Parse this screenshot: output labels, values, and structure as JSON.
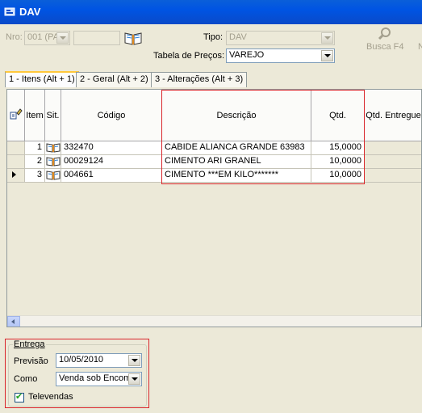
{
  "window": {
    "title": "DAV"
  },
  "form": {
    "nro_label": "Nro:",
    "nro_value": "001 (PA'",
    "nro2_value": "",
    "tipo_label": "Tipo:",
    "tipo_value": "DAV",
    "tabela_label": "Tabela de Preços:",
    "tabela_value": "VAREJO",
    "busca_label": "Busca F4"
  },
  "tabs": [
    {
      "label": "1 - Itens (Alt + 1)"
    },
    {
      "label": "2 - Geral (Alt + 2)"
    },
    {
      "label": "3 - Alterações (Alt + 3)"
    }
  ],
  "grid": {
    "columns": [
      "Item",
      "Sit.",
      "Código",
      "Descrição",
      "Qtd.",
      "Qtd. Entregue"
    ],
    "rows": [
      {
        "item": "1",
        "codigo": "332470",
        "descricao": "CABIDE ALIANCA GRANDE 63983",
        "qtd": "15,0000",
        "entregue": ""
      },
      {
        "item": "2",
        "codigo": "00029124",
        "descricao": "CIMENTO ARI GRANEL",
        "qtd": "10,0000",
        "entregue": ""
      },
      {
        "item": "3",
        "codigo": "004661",
        "descricao": "CIMENTO ***EM KILO*******",
        "qtd": "10,0000",
        "entregue": ""
      }
    ]
  },
  "entrega": {
    "legend": "Entrega",
    "previsao_label": "Previsão",
    "previsao_value": "10/05/2010",
    "como_label": "Como",
    "como_value": "Venda sob Encom",
    "televendas_label": "Televendas",
    "televendas_checked": true
  },
  "colors": {
    "titlebar": "#0054e3",
    "highlight": "#d9252b",
    "background": "#ece9d8"
  }
}
